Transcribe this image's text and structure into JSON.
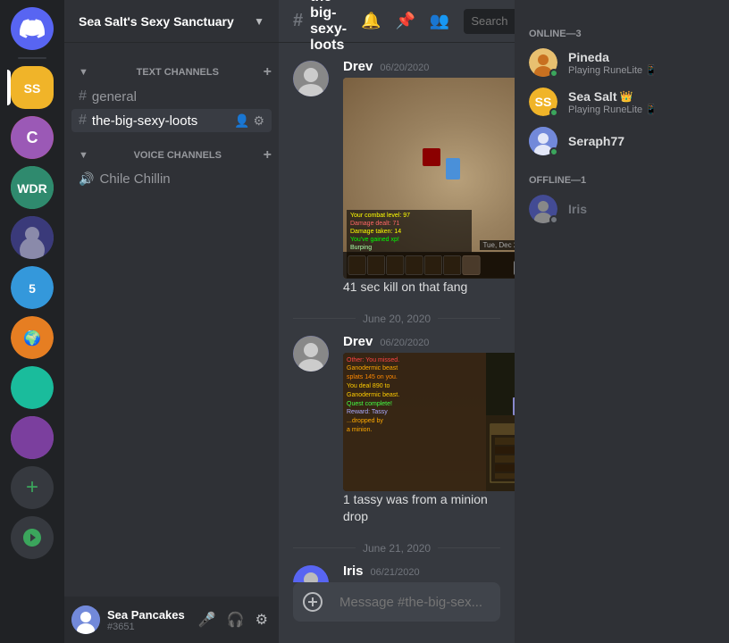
{
  "app": {
    "title": "DISCORD"
  },
  "server": {
    "name": "Sea Salt's Sexy Sanctuary",
    "channel": "the-big-sexy-loots"
  },
  "sidebar": {
    "categories": [
      {
        "name": "TEXT CHANNELS",
        "channels": [
          {
            "id": "general",
            "name": "general",
            "type": "text",
            "active": false
          },
          {
            "id": "the-big-sexy-loots",
            "name": "the-big-sexy-loots",
            "type": "text",
            "active": true
          }
        ]
      },
      {
        "name": "VOICE CHANNELS",
        "channels": [
          {
            "id": "chile-chillin",
            "name": "Chile Chillin",
            "type": "voice",
            "active": false
          }
        ]
      }
    ]
  },
  "members": {
    "online_label": "ONLINE—3",
    "offline_label": "OFFLINE—1",
    "online": [
      {
        "name": "Pineda",
        "status": "Playing RuneLite",
        "badge": "📱"
      },
      {
        "name": "Sea Salt",
        "status": "Playing RuneLite",
        "badge": "👑📱"
      },
      {
        "name": "Seraph77",
        "status": "",
        "badge": ""
      }
    ],
    "offline": [
      {
        "name": "Iris",
        "status": "",
        "badge": ""
      }
    ]
  },
  "messages": [
    {
      "id": "msg1",
      "author": "Drev",
      "timestamp": "06/20/2020",
      "text": "41 sec kill on that fang",
      "has_image": true
    },
    {
      "id": "divider1",
      "type": "date",
      "label": "June 20, 2020"
    },
    {
      "id": "msg2",
      "author": "Drev",
      "timestamp": "06/20/2020",
      "text": "1 tassy was from a minion drop",
      "has_image": true
    },
    {
      "id": "divider2",
      "type": "date",
      "label": "June 21, 2020"
    },
    {
      "id": "msg3",
      "author": "Iris",
      "timestamp": "06/21/2020",
      "text": "",
      "has_image": true,
      "partial": true
    }
  ],
  "chat_input": {
    "placeholder": "Message #the-big-sex..."
  },
  "header": {
    "search_placeholder": "Search"
  },
  "user": {
    "name": "Sea Pancakes",
    "tag": "#3651"
  },
  "servers": [
    {
      "id": "discord-home",
      "icon": "discord",
      "label": "Discord"
    },
    {
      "id": "server1",
      "initials": "S",
      "color": "#f0b429",
      "label": "Sea Salt"
    },
    {
      "id": "server2",
      "initials": "C",
      "color": "#e74c3c",
      "label": "Server C"
    },
    {
      "id": "server3",
      "initials": "W",
      "color": "#2ecc71",
      "label": "WDR"
    },
    {
      "id": "server4",
      "initials": "",
      "color": "#8e44ad",
      "label": "Server 4"
    },
    {
      "id": "server5",
      "initials": "",
      "color": "#3498db",
      "label": "Server 5"
    },
    {
      "id": "server6",
      "initials": "",
      "color": "#e67e22",
      "label": "Server 6"
    },
    {
      "id": "server7",
      "initials": "",
      "color": "#1abc9c",
      "label": "Server 7"
    },
    {
      "id": "server8",
      "initials": "",
      "color": "#9b59b6",
      "label": "Server 8"
    }
  ]
}
